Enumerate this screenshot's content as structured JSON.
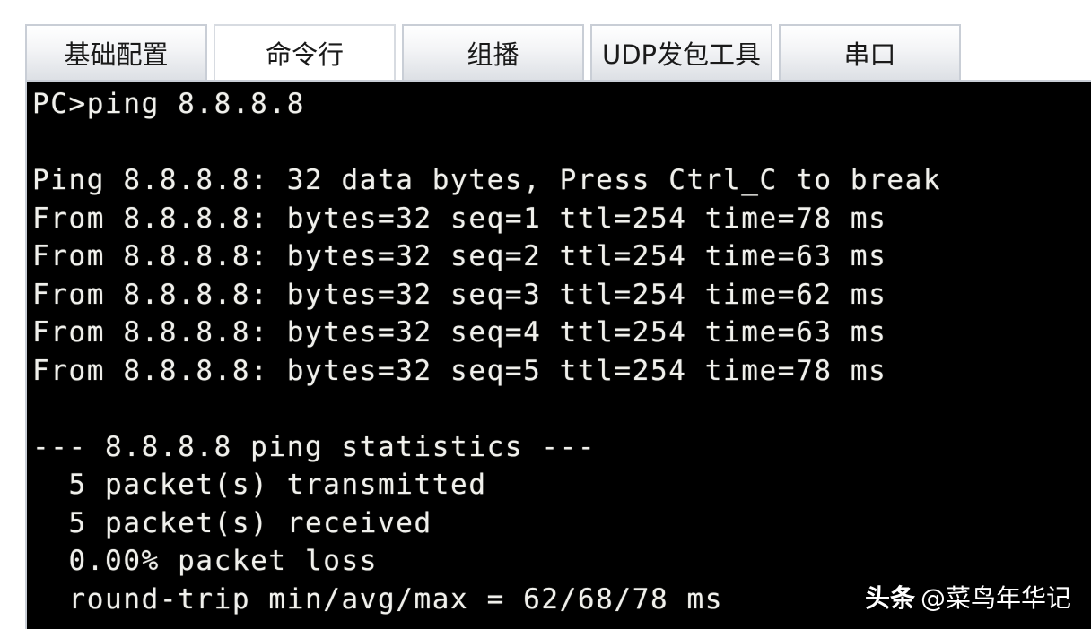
{
  "tabs": [
    {
      "label": "基础配置",
      "active": false
    },
    {
      "label": "命令行",
      "active": true
    },
    {
      "label": "组播",
      "active": false
    },
    {
      "label": "UDP发包工具",
      "active": false
    },
    {
      "label": "串口",
      "active": false
    }
  ],
  "terminal": {
    "lines": [
      "PC>ping 8.8.8.8",
      "",
      "Ping 8.8.8.8: 32 data bytes, Press Ctrl_C to break",
      "From 8.8.8.8: bytes=32 seq=1 ttl=254 time=78 ms",
      "From 8.8.8.8: bytes=32 seq=2 ttl=254 time=63 ms",
      "From 8.8.8.8: bytes=32 seq=3 ttl=254 time=62 ms",
      "From 8.8.8.8: bytes=32 seq=4 ttl=254 time=63 ms",
      "From 8.8.8.8: bytes=32 seq=5 ttl=254 time=78 ms",
      "",
      "--- 8.8.8.8 ping statistics ---",
      "  5 packet(s) transmitted",
      "  5 packet(s) received",
      "  0.00% packet loss",
      "  round-trip min/avg/max = 62/68/78 ms"
    ]
  },
  "watermark": {
    "brand": "头条",
    "handle": "@菜鸟年华记"
  },
  "colors": {
    "terminal_bg": "#000000",
    "terminal_text": "#f0f0ec",
    "tab_border": "#c9ced6"
  }
}
